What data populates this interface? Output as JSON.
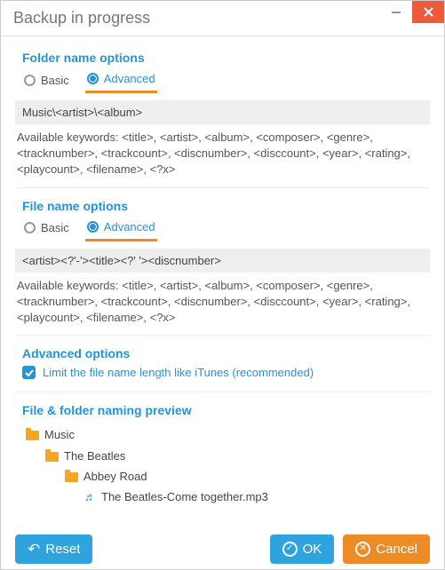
{
  "window": {
    "title": "Backup in progress"
  },
  "folder_options": {
    "title": "Folder name options",
    "basic_label": "Basic",
    "advanced_label": "Advanced",
    "pattern": "Music\\<artist>\\<album>",
    "hint": "Available keywords: <title>, <artist>, <album>, <composer>, <genre>, <tracknumber>, <trackcount>, <discnumber>, <disccount>, <year>, <rating>, <playcount>, <filename>, <?x>"
  },
  "file_options": {
    "title": "File name options",
    "basic_label": "Basic",
    "advanced_label": "Advanced",
    "pattern": "<artist><?'-'><title><?' '><discnumber>",
    "hint": "Available keywords: <title>, <artist>, <album>, <composer>, <genre>, <tracknumber>, <trackcount>, <discnumber>, <disccount>, <year>, <rating>, <playcount>, <filename>, <?x>"
  },
  "advanced_options": {
    "title": "Advanced options",
    "limit_label": "Limit the file name length like iTunes (recommended)",
    "limit_checked": true
  },
  "preview": {
    "title": "File & folder naming preview",
    "root": "Music",
    "artist": "The Beatles",
    "album": "Abbey Road",
    "file": "The Beatles-Come together.mp3"
  },
  "buttons": {
    "reset": "Reset",
    "ok": "OK",
    "cancel": "Cancel"
  }
}
